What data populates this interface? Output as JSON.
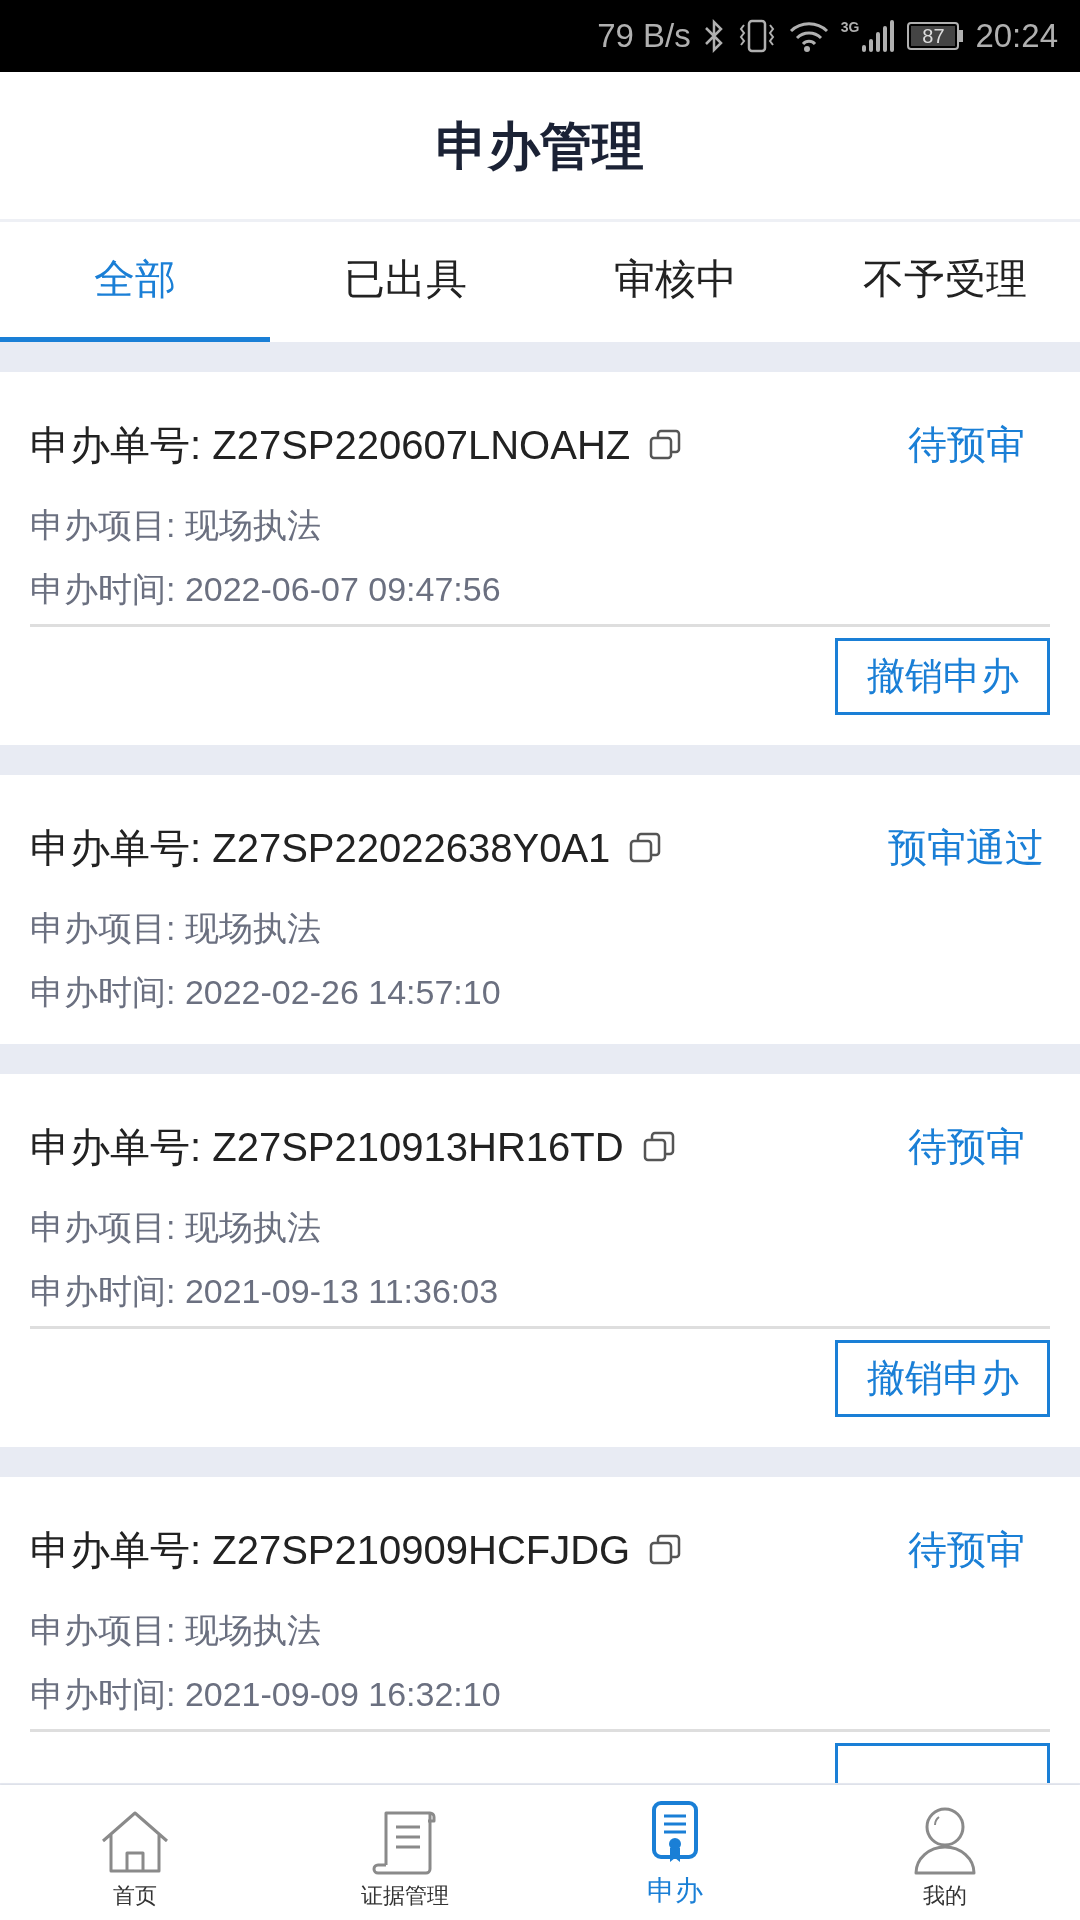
{
  "status_bar": {
    "net_speed": "79 B/s",
    "network": "3G",
    "battery": "87",
    "time": "20:24"
  },
  "header": {
    "title": "申办管理"
  },
  "tabs": [
    {
      "label": "全部",
      "selected": true
    },
    {
      "label": "已出具",
      "selected": false
    },
    {
      "label": "审核中",
      "selected": false
    },
    {
      "label": "不予受理",
      "selected": false
    }
  ],
  "applications": [
    {
      "number": "申办单号: Z27SP220607LNOAHZ",
      "status": "待预审",
      "project": "申办项目: 现场执法",
      "time": "申办时间: 2022-06-07 09:47:56",
      "action": "撤销申办"
    },
    {
      "number": "申办单号: Z27SP22022638Y0A1",
      "status": "预审通过",
      "project": "申办项目: 现场执法",
      "time": "申办时间: 2022-02-26 14:57:10"
    },
    {
      "number": "申办单号: Z27SP210913HR16TD",
      "status": "待预审",
      "project": "申办项目: 现场执法",
      "time": "申办时间: 2021-09-13 11:36:03",
      "action": "撤销申办"
    },
    {
      "number": "申办单号: Z27SP210909HCFJDG",
      "status": "待预审",
      "project": "申办项目: 现场执法",
      "time": "申办时间: 2021-09-09 16:32:10",
      "button_cut_off": true
    }
  ],
  "bottom_nav": [
    {
      "kind": "home",
      "label": "首页",
      "selected": false
    },
    {
      "kind": "scroll",
      "label": "证据管理",
      "selected": false
    },
    {
      "kind": "certificate",
      "label": "申办",
      "selected": true
    },
    {
      "kind": "person",
      "label": "我的",
      "selected": false
    }
  ]
}
